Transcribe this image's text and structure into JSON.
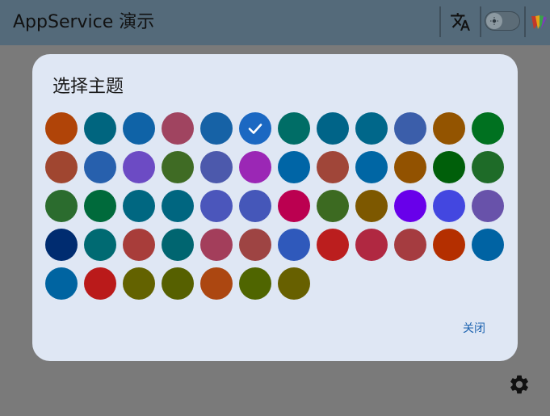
{
  "app": {
    "title": "AppService 演示"
  },
  "toolbar": {
    "translate_icon": "translate-icon",
    "toggle_icon": "brightness-icon",
    "theme_icon": "palette-icon"
  },
  "dialog": {
    "title": "选择主题",
    "close_label": "关闭",
    "selected_index": 5,
    "swatches": [
      "#b04408",
      "#00657f",
      "#0f63a7",
      "#a04460",
      "#1662a6",
      "#1b68c2",
      "#006d66",
      "#006488",
      "#00678a",
      "#3b5eaa",
      "#935400",
      "#007120",
      "#a04630",
      "#2760ad",
      "#6c4bc4",
      "#3f6b24",
      "#4c59ac",
      "#9b27b5",
      "#0065a6",
      "#a04639",
      "#0066a4",
      "#925200",
      "#005f0a",
      "#1e6b28",
      "#2b6c2e",
      "#006a3b",
      "#006781",
      "#006680",
      "#4b56bb",
      "#4557b9",
      "#bb0050",
      "#3c6a21",
      "#7d5800",
      "#6800ea",
      "#4347e0",
      "#6852aa",
      "#002c70",
      "#006a72",
      "#a83d3a",
      "#006570",
      "#a33e5b",
      "#9e4443",
      "#2f59bb",
      "#bb1e1e",
      "#b02841",
      "#a53c40",
      "#b42f00",
      "#0063a3",
      "#0064a1",
      "#ba1a1a",
      "#636200",
      "#566000",
      "#ac4711",
      "#4f6500",
      "#676000"
    ]
  },
  "bottom": {
    "settings_icon": "gear-icon"
  }
}
